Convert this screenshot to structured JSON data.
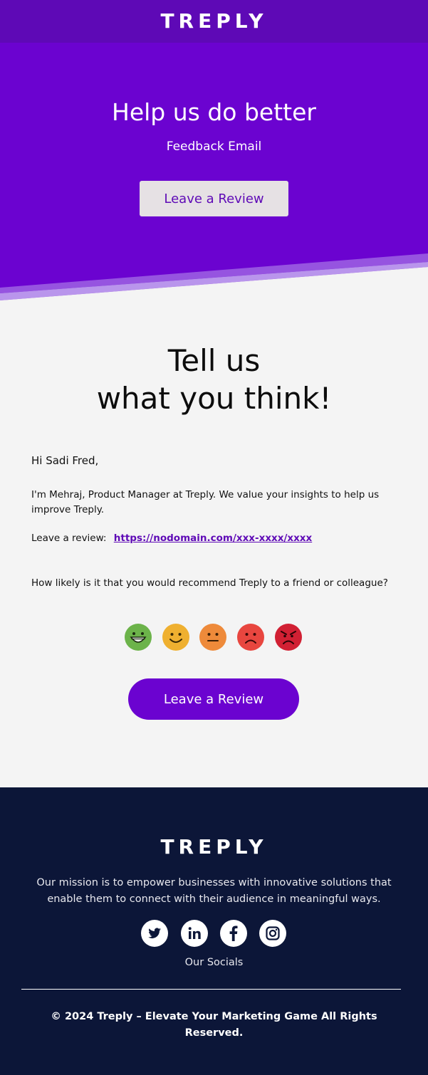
{
  "header": {
    "logo": "TREPLY"
  },
  "hero": {
    "title": "Help us do better",
    "subtitle": "Feedback Email",
    "button_label": "Leave a Review"
  },
  "main": {
    "heading_line1": "Tell us",
    "heading_line2": "what you think!",
    "greeting": "Hi Sadi Fred,",
    "intro": "I'm Mehraj, Product Manager at Treply. We value your insights to help us improve Treply.",
    "review_prefix": "Leave a review:",
    "review_link": "https://nodomain.com/xxx-xxxx/xxxx",
    "question": "How likely is it that you would recommend Treply to a friend or colleague?",
    "ratings": [
      {
        "icon": "grinning-face-icon",
        "color": "#6cb34a"
      },
      {
        "icon": "smiling-face-icon",
        "color": "#efb030"
      },
      {
        "icon": "neutral-face-icon",
        "color": "#ee8a3a"
      },
      {
        "icon": "frowning-face-icon",
        "color": "#e8463f"
      },
      {
        "icon": "angry-face-icon",
        "color": "#d12033"
      }
    ],
    "button_label": "Leave a Review"
  },
  "footer": {
    "logo": "TREPLY",
    "mission": "Our mission is to empower businesses with innovative solutions that enable them to connect with their audience in meaningful ways.",
    "socials": [
      "twitter-icon",
      "linkedin-icon",
      "facebook-icon",
      "instagram-icon"
    ],
    "socials_label": "Our Socials",
    "copyright": "© 2024 Treply – Elevate Your Marketing Game All Rights Reserved."
  },
  "colors": {
    "brand_purple": "#6b03d0",
    "topbar_purple": "#5e09b6",
    "footer_navy": "#0c1638",
    "background": "#f4f4f4"
  }
}
